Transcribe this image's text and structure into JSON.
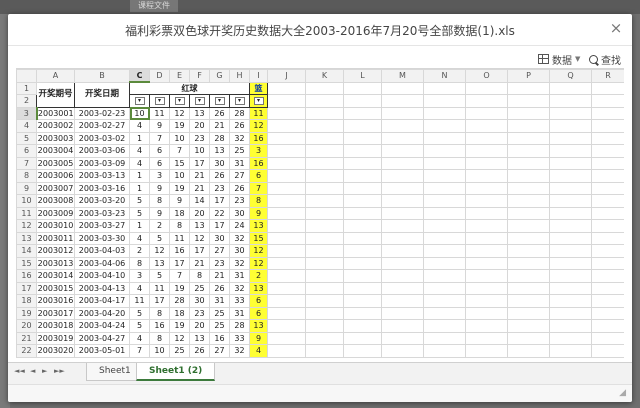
{
  "background": {
    "tab_label": "课程文件"
  },
  "modal": {
    "title": "福利彩票双色球开奖历史数据大全2003-2016年7月20号全部数据(1).xls",
    "close_glyph": "×"
  },
  "toolbar": {
    "data_label": "数据",
    "find_label": "查找"
  },
  "sheet": {
    "column_letters": [
      "A",
      "B",
      "C",
      "D",
      "E",
      "F",
      "G",
      "H",
      "I",
      "J",
      "K",
      "L",
      "M",
      "N",
      "O",
      "P",
      "Q",
      "R"
    ],
    "selected_column": "C",
    "header": {
      "issue_label": "开奖期号",
      "date_label": "开奖日期",
      "red_label": "红球",
      "blue_label": "篮"
    },
    "rows": [
      {
        "n": "3",
        "issue": "2003001",
        "date": "2003-02-23",
        "red": [
          "10",
          "11",
          "12",
          "13",
          "26",
          "28"
        ],
        "blue": "11"
      },
      {
        "n": "4",
        "issue": "2003002",
        "date": "2003-02-27",
        "red": [
          "4",
          "9",
          "19",
          "20",
          "21",
          "26"
        ],
        "blue": "12"
      },
      {
        "n": "5",
        "issue": "2003003",
        "date": "2003-03-02",
        "red": [
          "1",
          "7",
          "10",
          "23",
          "28",
          "32"
        ],
        "blue": "16"
      },
      {
        "n": "6",
        "issue": "2003004",
        "date": "2003-03-06",
        "red": [
          "4",
          "6",
          "7",
          "10",
          "13",
          "25"
        ],
        "blue": "3"
      },
      {
        "n": "7",
        "issue": "2003005",
        "date": "2003-03-09",
        "red": [
          "4",
          "6",
          "15",
          "17",
          "30",
          "31"
        ],
        "blue": "16"
      },
      {
        "n": "8",
        "issue": "2003006",
        "date": "2003-03-13",
        "red": [
          "1",
          "3",
          "10",
          "21",
          "26",
          "27"
        ],
        "blue": "6"
      },
      {
        "n": "9",
        "issue": "2003007",
        "date": "2003-03-16",
        "red": [
          "1",
          "9",
          "19",
          "21",
          "23",
          "26"
        ],
        "blue": "7"
      },
      {
        "n": "10",
        "issue": "2003008",
        "date": "2003-03-20",
        "red": [
          "5",
          "8",
          "9",
          "14",
          "17",
          "23"
        ],
        "blue": "8"
      },
      {
        "n": "11",
        "issue": "2003009",
        "date": "2003-03-23",
        "red": [
          "5",
          "9",
          "18",
          "20",
          "22",
          "30"
        ],
        "blue": "9"
      },
      {
        "n": "12",
        "issue": "2003010",
        "date": "2003-03-27",
        "red": [
          "1",
          "2",
          "8",
          "13",
          "17",
          "24"
        ],
        "blue": "13"
      },
      {
        "n": "13",
        "issue": "2003011",
        "date": "2003-03-30",
        "red": [
          "4",
          "5",
          "11",
          "12",
          "30",
          "32"
        ],
        "blue": "15"
      },
      {
        "n": "14",
        "issue": "2003012",
        "date": "2003-04-03",
        "red": [
          "2",
          "12",
          "16",
          "17",
          "27",
          "30"
        ],
        "blue": "12"
      },
      {
        "n": "15",
        "issue": "2003013",
        "date": "2003-04-06",
        "red": [
          "8",
          "13",
          "17",
          "21",
          "23",
          "32"
        ],
        "blue": "12"
      },
      {
        "n": "16",
        "issue": "2003014",
        "date": "2003-04-10",
        "red": [
          "3",
          "5",
          "7",
          "8",
          "21",
          "31"
        ],
        "blue": "2"
      },
      {
        "n": "17",
        "issue": "2003015",
        "date": "2003-04-13",
        "red": [
          "4",
          "11",
          "19",
          "25",
          "26",
          "32"
        ],
        "blue": "13"
      },
      {
        "n": "18",
        "issue": "2003016",
        "date": "2003-04-17",
        "red": [
          "11",
          "17",
          "28",
          "30",
          "31",
          "33"
        ],
        "blue": "6"
      },
      {
        "n": "19",
        "issue": "2003017",
        "date": "2003-04-20",
        "red": [
          "5",
          "8",
          "18",
          "23",
          "25",
          "31"
        ],
        "blue": "6"
      },
      {
        "n": "20",
        "issue": "2003018",
        "date": "2003-04-24",
        "red": [
          "5",
          "16",
          "19",
          "20",
          "25",
          "28"
        ],
        "blue": "13"
      },
      {
        "n": "21",
        "issue": "2003019",
        "date": "2003-04-27",
        "red": [
          "4",
          "8",
          "12",
          "13",
          "16",
          "33"
        ],
        "blue": "9"
      },
      {
        "n": "22",
        "issue": "2003020",
        "date": "2003-05-01",
        "red": [
          "7",
          "10",
          "25",
          "26",
          "27",
          "32"
        ],
        "blue": "4"
      }
    ]
  },
  "tabs": {
    "sheets": [
      "Sheet1",
      "Sheet1 (2)"
    ],
    "active_index": 1,
    "nav_glyphs": [
      "◄◄",
      "◄",
      "►",
      "►►"
    ]
  },
  "colors": {
    "blue_ball_fill": "#ffff33",
    "selection": "#5b8a3c"
  }
}
